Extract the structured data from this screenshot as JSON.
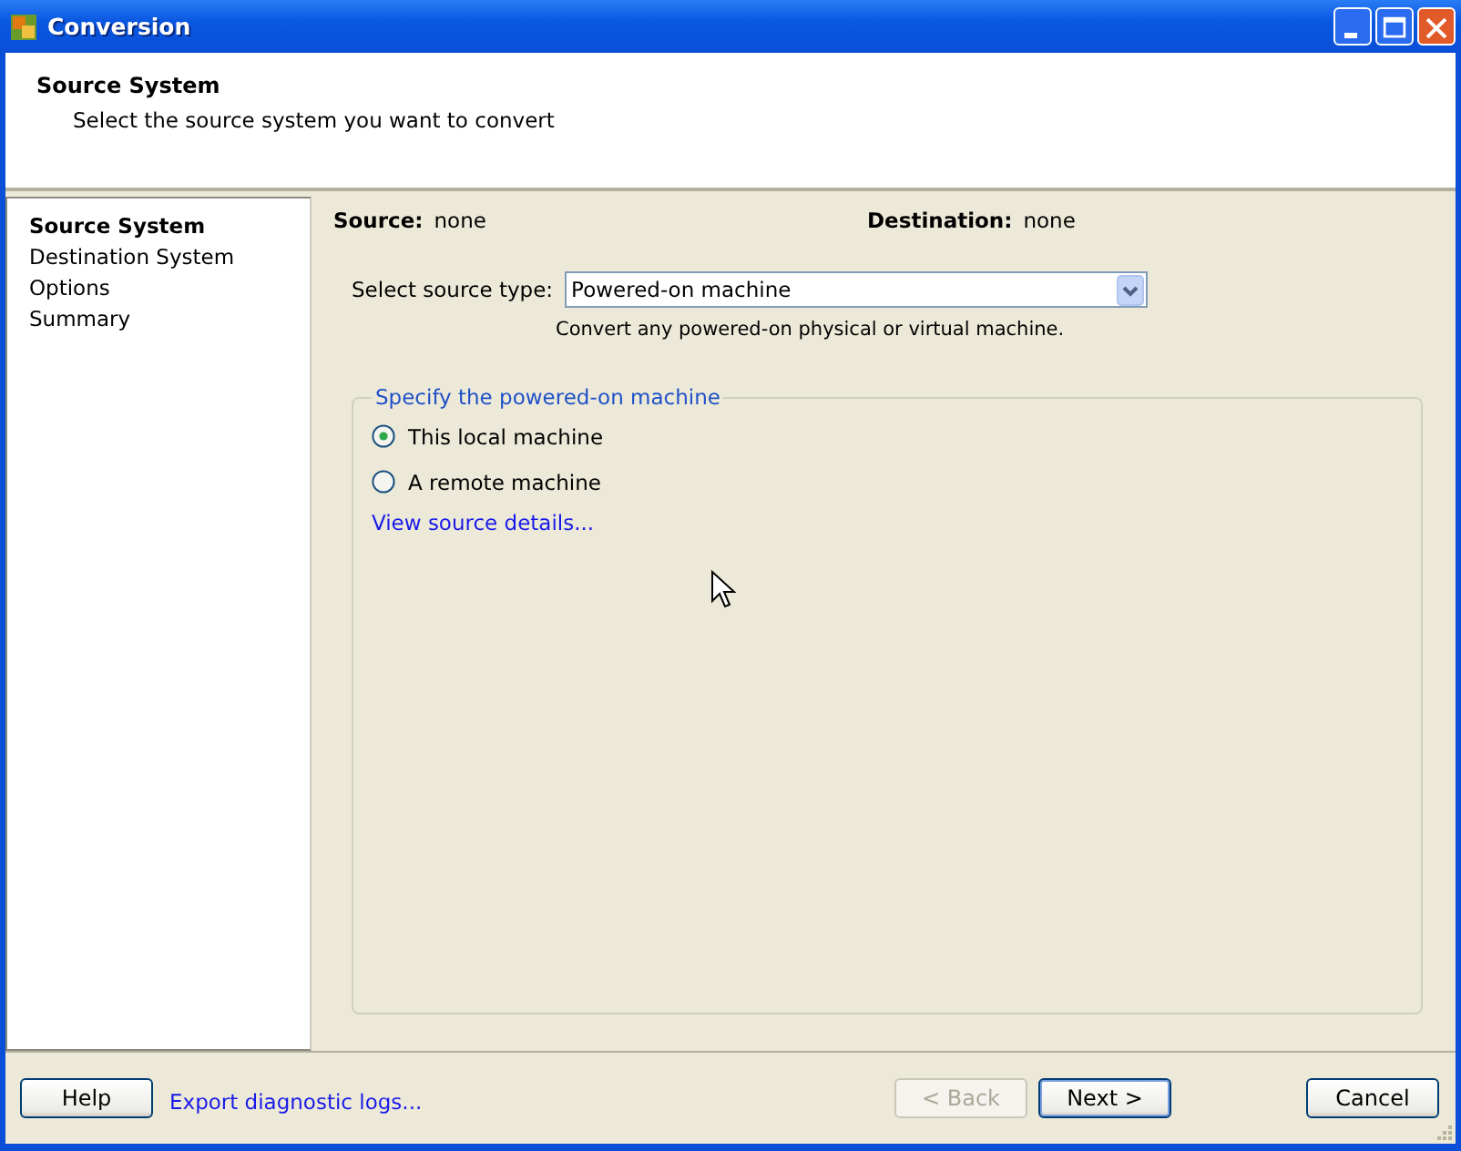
{
  "window": {
    "title": "Conversion"
  },
  "header": {
    "title": "Source System",
    "subtitle": "Select the source system you want to convert"
  },
  "sidebar": {
    "items": [
      {
        "label": "Source System",
        "selected": true
      },
      {
        "label": "Destination System",
        "selected": false
      },
      {
        "label": "Options",
        "selected": false
      },
      {
        "label": "Summary",
        "selected": false
      }
    ]
  },
  "summary": {
    "source_label": "Source:",
    "source_value": "none",
    "destination_label": "Destination:",
    "destination_value": "none"
  },
  "source_type": {
    "label": "Select source type:",
    "value": "Powered-on machine",
    "hint": "Convert any powered-on physical or virtual machine."
  },
  "group": {
    "title": "Specify the powered-on machine",
    "options": [
      {
        "label": "This local machine",
        "selected": true
      },
      {
        "label": "A remote machine",
        "selected": false
      }
    ],
    "link": "View source details..."
  },
  "footer": {
    "help": "Help",
    "export_link": "Export diagnostic logs...",
    "buttons": [
      {
        "label": "< Back",
        "disabled": true,
        "default": false
      },
      {
        "label": "Next >",
        "disabled": false,
        "default": true
      }
    ],
    "cancel": "Cancel"
  }
}
